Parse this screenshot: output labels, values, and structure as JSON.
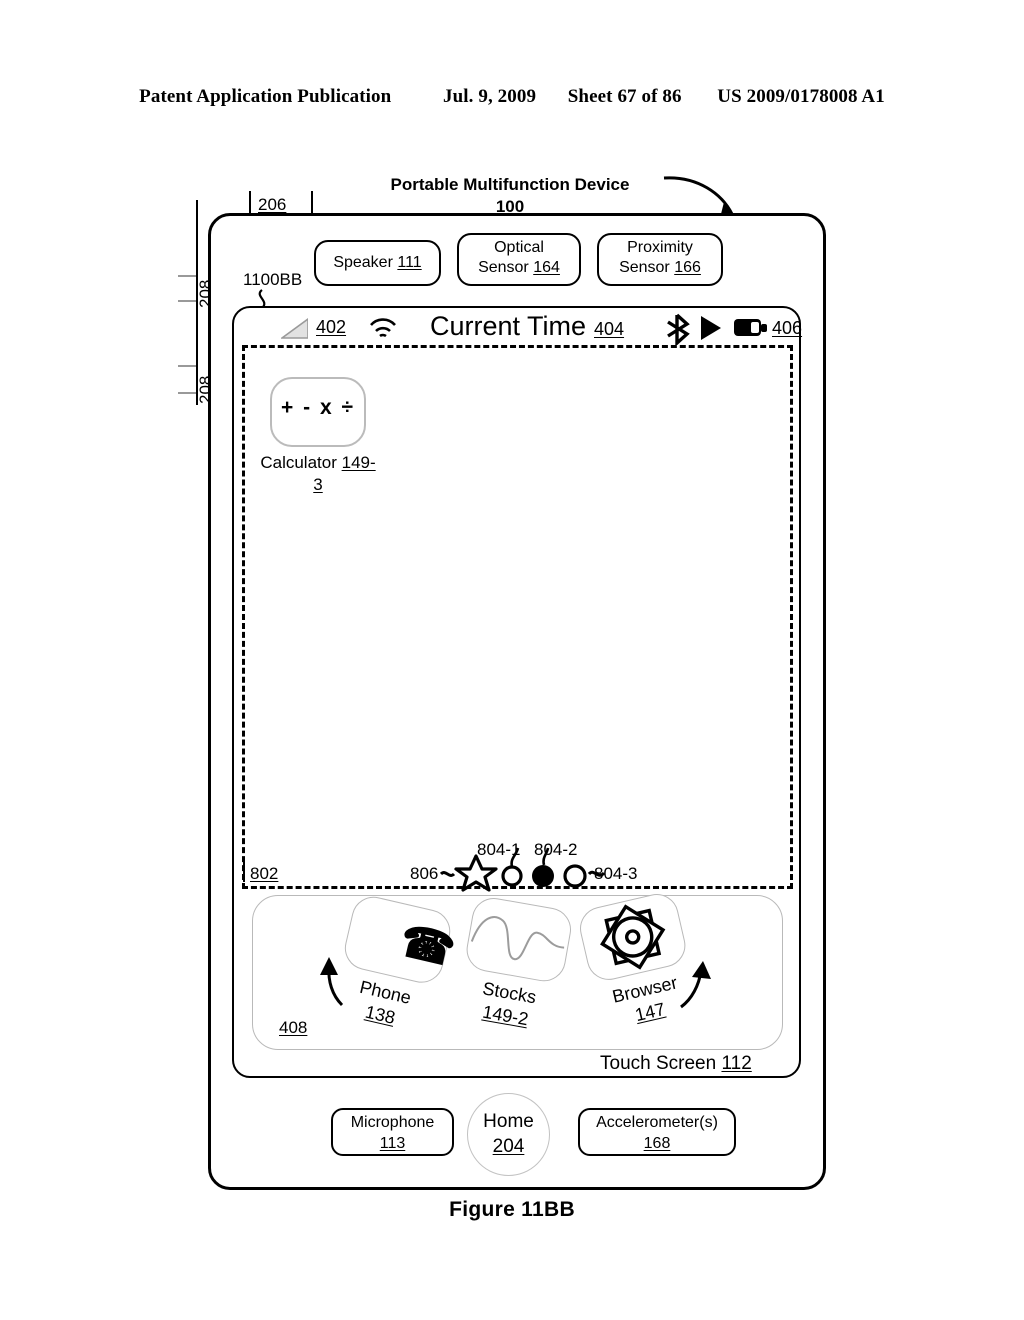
{
  "publication_header": {
    "left": "Patent Application Publication",
    "date": "Jul. 9, 2009",
    "sheet": "Sheet 67 of 86",
    "number": "US 2009/0178008 A1"
  },
  "figure_caption": "Figure 11BB",
  "device": {
    "title": "Portable Multifunction Device",
    "title_number": "100",
    "ui_state_label": "1100BB",
    "top_button_label": "206",
    "side_button_labels": [
      "208",
      "208"
    ],
    "sensors": [
      {
        "name": "speaker",
        "line1": "Speaker",
        "number": "111"
      },
      {
        "name": "optical-sensor",
        "line1": "Optical",
        "line2": "Sensor",
        "number": "164"
      },
      {
        "name": "proximity-sensor",
        "line1": "Proximity",
        "line2": "Sensor",
        "number": "166"
      }
    ],
    "touch_screen": {
      "label": "Touch Screen",
      "number": "112"
    },
    "hardware": {
      "microphone": {
        "label": "Microphone",
        "number": "113"
      },
      "home": {
        "label": "Home",
        "number": "204"
      },
      "accelerometer": {
        "label": "Accelerometer(s)",
        "number": "168"
      }
    }
  },
  "status_bar": {
    "signal_icon": "signal-strength-icon",
    "signal_number": "402",
    "wifi_icon": "wifi-icon",
    "time_label": "Current Time",
    "time_number": "404",
    "bluetooth_icon": "bluetooth-icon",
    "play_icon": "play-icon",
    "battery_icon": "battery-icon",
    "battery_number": "406"
  },
  "app_area": {
    "region_number": "802",
    "apps": [
      {
        "name": "calculator",
        "glyph": "+ - x ÷",
        "label": "Calculator",
        "number": "149-3"
      }
    ]
  },
  "page_indicators": {
    "star_number": "806",
    "dot_numbers": [
      "804-1",
      "804-2",
      "804-3"
    ],
    "dots": [
      {
        "type": "star",
        "filled": false
      },
      {
        "type": "circle",
        "filled": false
      },
      {
        "type": "circle",
        "filled": true
      },
      {
        "type": "circle",
        "filled": false
      }
    ]
  },
  "dock": {
    "number": "408",
    "items": [
      {
        "name": "phone",
        "label": "Phone",
        "number": "138",
        "icon": "phone-handset-icon"
      },
      {
        "name": "stocks",
        "label": "Stocks",
        "number": "149-2",
        "icon": "stock-chart-icon"
      },
      {
        "name": "browser",
        "label": "Browser",
        "number": "147",
        "icon": "compass-icon"
      }
    ]
  }
}
